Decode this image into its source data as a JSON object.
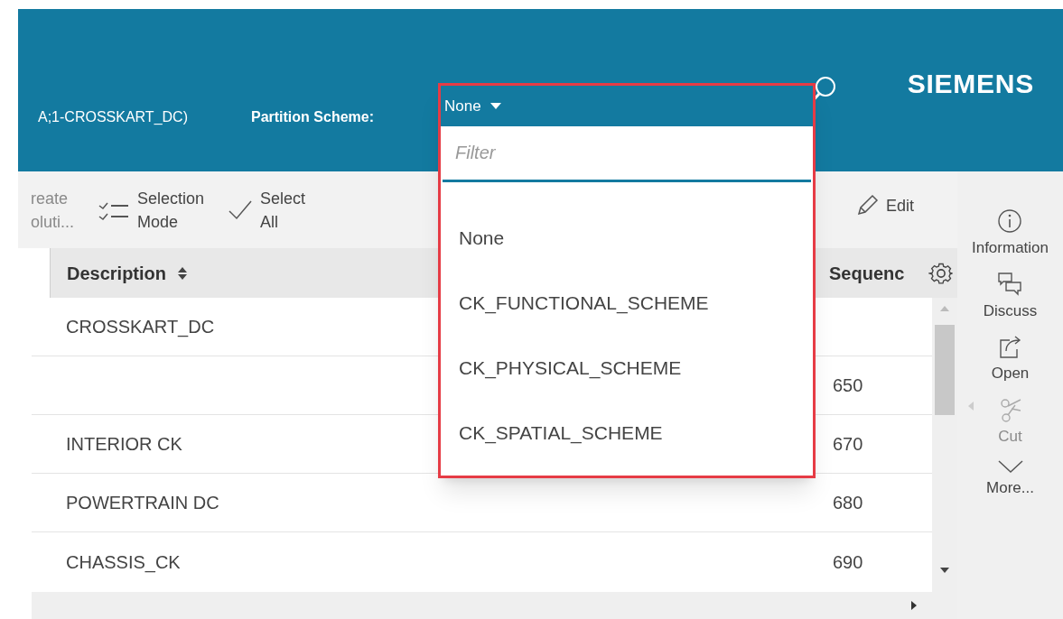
{
  "header": {
    "context": "A;1-CROSSKART_DC)",
    "partition_label": "Partition Scheme:",
    "brand": "SIEMENS"
  },
  "toolbar": [
    {
      "kind": "create",
      "lines": [
        "reate",
        "oluti..."
      ],
      "disabled": true
    },
    {
      "kind": "selection",
      "lines": [
        "Selection",
        "Mode"
      ],
      "disabled": false
    },
    {
      "kind": "select_all",
      "lines": [
        "Select",
        "All"
      ],
      "disabled": false
    },
    {
      "kind": "edit",
      "lines": [
        "Edit"
      ],
      "disabled": false
    }
  ],
  "table": {
    "columns": [
      "Description",
      "Sequenc"
    ],
    "rows": [
      {
        "description": "CROSSKART_DC"
      },
      {
        "sequence": "650"
      },
      {
        "description": "INTERIOR CK",
        "sequence": "670"
      },
      {
        "description": "POWERTRAIN DC",
        "sequence": "680"
      },
      {
        "description": "CHASSIS_CK",
        "sequence": "690"
      }
    ]
  },
  "side_actions": [
    {
      "kind": "info",
      "label": "Information",
      "disabled": false
    },
    {
      "kind": "discuss",
      "label": "Discuss",
      "disabled": false
    },
    {
      "kind": "open",
      "label": "Open",
      "disabled": false
    },
    {
      "kind": "cut",
      "label": "Cut",
      "disabled": true
    },
    {
      "kind": "more",
      "label": "More...",
      "disabled": false
    }
  ],
  "dropdown": {
    "value": "None",
    "filter": {
      "placeholder": "Filter"
    },
    "options": [
      {
        "label": "None"
      },
      {
        "label": "CK_FUNCTIONAL_SCHEME"
      },
      {
        "label": "CK_PHYSICAL_SCHEME"
      },
      {
        "label": "CK_SPATIAL_SCHEME"
      }
    ]
  }
}
